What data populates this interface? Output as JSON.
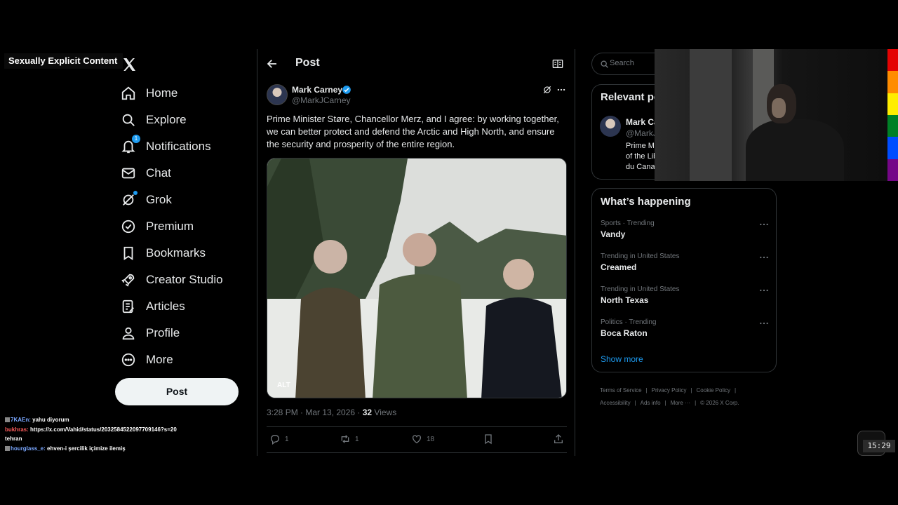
{
  "overlay": {
    "label": "Sexually Explicit Content"
  },
  "nav": {
    "items": [
      {
        "label": "Home",
        "icon": "home-icon"
      },
      {
        "label": "Explore",
        "icon": "search-icon"
      },
      {
        "label": "Notifications",
        "icon": "bell-icon",
        "badge": "1"
      },
      {
        "label": "Chat",
        "icon": "mail-icon"
      },
      {
        "label": "Grok",
        "icon": "grok-icon"
      },
      {
        "label": "Premium",
        "icon": "verified-icon"
      },
      {
        "label": "Bookmarks",
        "icon": "bookmark-icon"
      },
      {
        "label": "Creator Studio",
        "icon": "rocket-icon"
      },
      {
        "label": "Articles",
        "icon": "articles-icon"
      },
      {
        "label": "Profile",
        "icon": "person-icon"
      },
      {
        "label": "More",
        "icon": "more-circle-icon"
      }
    ],
    "post_button": "Post"
  },
  "chat": {
    "messages": [
      {
        "user": "7KAEn:",
        "text": "yahu diyorum"
      },
      {
        "user": "bukhras:",
        "text": "https://x.com/Vahid/status/2032584522097709146?s=20"
      },
      {
        "user": "",
        "text": "tehran"
      },
      {
        "user": "hourglass_e:",
        "text": "ehven-i şercilik içimize ilemiş"
      }
    ]
  },
  "header": {
    "title": "Post"
  },
  "tweet": {
    "author_name": "Mark Carney",
    "author_handle": "@MarkJCarney",
    "text": "Prime Minister Støre, Chancellor Merz, and I agree: by working together, we can better protect and defend the Arctic and High North, and ensure the security and prosperity of the entire region.",
    "alt_label": "ALT",
    "time": "3:28 PM · Mar 13, 2026 · ",
    "views_count": "32",
    "views_label": " Views",
    "replies": "1",
    "reposts": "1",
    "likes": "18"
  },
  "search": {
    "placeholder": "Search"
  },
  "relevant": {
    "title": "Relevant people",
    "name": "Mark Carney",
    "handle": "@MarkJCarney",
    "bio_lines": [
      "Prime Minister",
      "of the Liberal Party",
      "du Canada"
    ]
  },
  "trends": {
    "title": "What’s happening",
    "items": [
      {
        "context": "Sports · Trending",
        "name": "Vandy"
      },
      {
        "context": "Trending in United States",
        "name": "Creamed"
      },
      {
        "context": "Trending in United States",
        "name": "North Texas"
      },
      {
        "context": "Politics · Trending",
        "name": "Boca Raton"
      }
    ],
    "show_more": "Show more"
  },
  "footer": {
    "links": [
      "Terms of Service",
      "Privacy Policy",
      "Cookie Policy",
      "Accessibility",
      "Ads info",
      "More ···"
    ],
    "copyright": "© 2026 X Corp."
  },
  "clock": "15:29",
  "colors": {
    "accent": "#1d9bf0",
    "background": "#000000",
    "border": "#2f3336",
    "muted": "#71767b"
  }
}
